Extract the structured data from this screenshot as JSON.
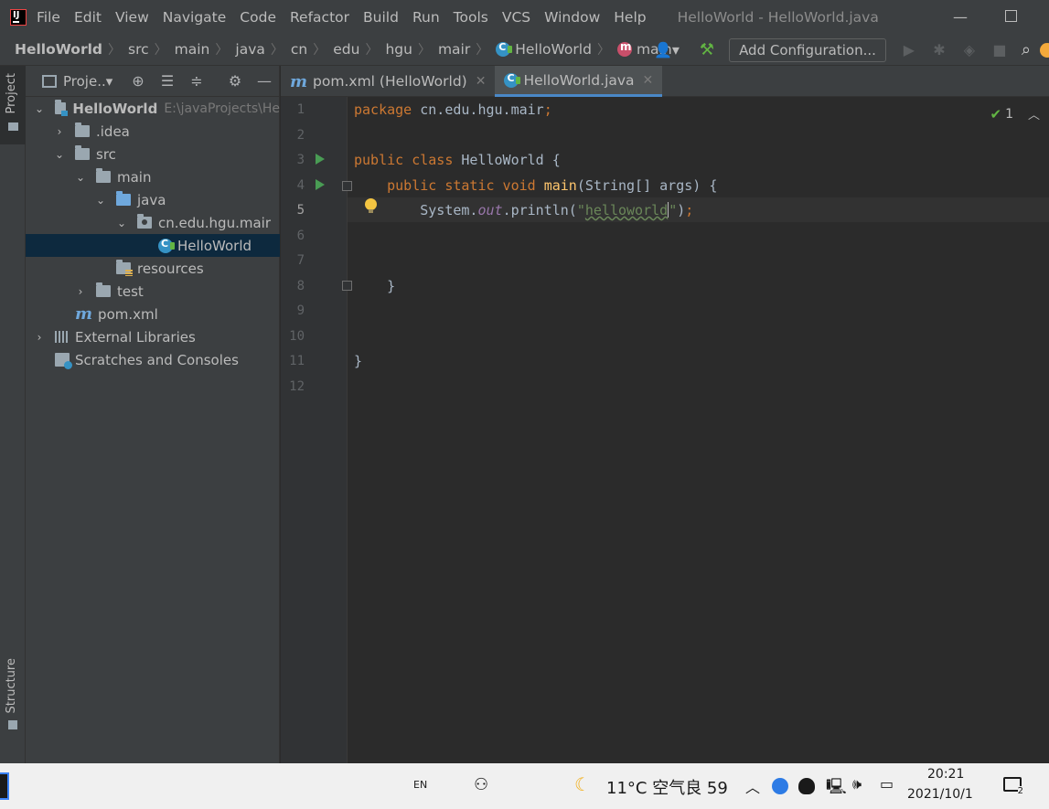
{
  "menubar": {
    "items": [
      "File",
      "Edit",
      "View",
      "Navigate",
      "Code",
      "Refactor",
      "Build",
      "Run",
      "Tools",
      "VCS",
      "Window",
      "Help"
    ],
    "window_title": "HelloWorld - HelloWorld.java"
  },
  "navbar": {
    "breadcrumb": [
      "HelloWorld",
      "src",
      "main",
      "java",
      "cn",
      "edu",
      "hgu",
      "mair",
      "HelloWorld",
      "main"
    ],
    "add_configuration": "Add Configuration..."
  },
  "tool_stripe": {
    "project_label": "Project",
    "structure_label": "Structure"
  },
  "project_panel": {
    "view_label": "Proje..▾",
    "tree": [
      {
        "label": "HelloWorld",
        "path": "E:\\javaProjects\\He"
      },
      {
        "label": ".idea"
      },
      {
        "label": "src"
      },
      {
        "label": "main"
      },
      {
        "label": "java"
      },
      {
        "label": "cn.edu.hgu.mair"
      },
      {
        "label": "HelloWorld"
      },
      {
        "label": "resources"
      },
      {
        "label": "test"
      },
      {
        "label": "pom.xml"
      },
      {
        "label": "External Libraries"
      },
      {
        "label": "Scratches and Consoles"
      }
    ]
  },
  "editor": {
    "tabs": [
      {
        "label": "pom.xml (HelloWorld)"
      },
      {
        "label": "HelloWorld.java"
      }
    ],
    "line_numbers": [
      "1",
      "2",
      "3",
      "4",
      "5",
      "6",
      "7",
      "8",
      "9",
      "10",
      "11",
      "12"
    ],
    "current_line": "5",
    "inspection_count": "1",
    "code": {
      "l1_kw": "package",
      "l1_rest": " cn.edu.hgu.mair",
      "l1_semi": ";",
      "l3_kw": "public class",
      "l3_rest": " HelloWorld {",
      "l4_indent": "    ",
      "l4_kw": "public static void",
      "l4_sp": " ",
      "l4_fn": "main",
      "l4_rest": "(String[] args) {",
      "l5_pre": "        System.",
      "l5_field": "out",
      "l5_mid": ".println(",
      "l5_str_open": "\"",
      "l5_str": "helloworld",
      "l5_str_close": "\"",
      "l5_end": ")",
      "l5_semi": ";",
      "l8": "    }",
      "l11": "}"
    }
  },
  "taskbar": {
    "lang": "EN",
    "weather": "11°C  空气良 59",
    "time": "20:21",
    "date": "2021/10/1",
    "notifications": "2"
  },
  "colors": {
    "keyword": "#cc7832",
    "function": "#ffc66d",
    "string": "#6a8759",
    "field": "#9876aa",
    "plain": "#a9b7c6",
    "selection": "#0d293e",
    "run_icon": "#499c54"
  }
}
